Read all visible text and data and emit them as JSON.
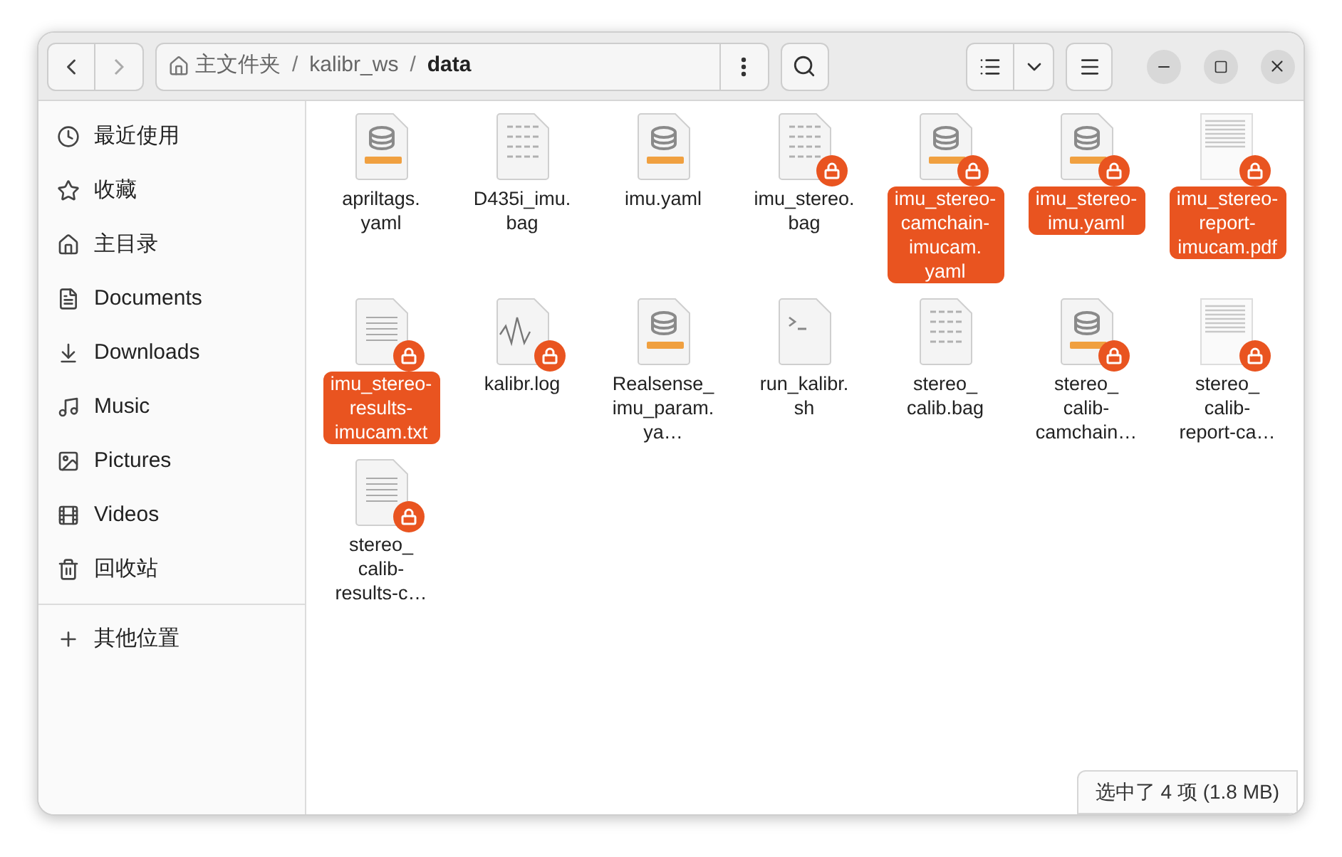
{
  "toolbar": {
    "path": [
      {
        "label": "主文件夹",
        "kind": "home",
        "current": false
      },
      {
        "label": "kalibr_ws",
        "kind": "folder",
        "current": false
      },
      {
        "label": "data",
        "kind": "folder",
        "current": true
      }
    ],
    "separator": "/"
  },
  "sidebar": {
    "items": [
      {
        "label": "最近使用",
        "kind": "recent"
      },
      {
        "label": "收藏",
        "kind": "starred"
      },
      {
        "label": "主目录",
        "kind": "home"
      },
      {
        "label": "Documents",
        "kind": "documents"
      },
      {
        "label": "Downloads",
        "kind": "downloads"
      },
      {
        "label": "Music",
        "kind": "music"
      },
      {
        "label": "Pictures",
        "kind": "pictures"
      },
      {
        "label": "Videos",
        "kind": "videos"
      },
      {
        "label": "回收站",
        "kind": "trash"
      }
    ],
    "other": {
      "label": "其他位置",
      "kind": "plus"
    }
  },
  "files": [
    {
      "name": "apriltags.yaml",
      "kind": "yaml",
      "locked": false,
      "selected": false
    },
    {
      "name": "D435i_imu.bag",
      "kind": "binary",
      "locked": false,
      "selected": false
    },
    {
      "name": "imu.yaml",
      "kind": "yaml",
      "locked": false,
      "selected": false
    },
    {
      "name": "imu_stereo.bag",
      "kind": "binary",
      "locked": true,
      "selected": false
    },
    {
      "name": "imu_stereo-camchain-imucam.yaml",
      "kind": "yaml",
      "locked": true,
      "selected": true
    },
    {
      "name": "imu_stereo-imu.yaml",
      "kind": "yaml",
      "locked": true,
      "selected": true
    },
    {
      "name": "imu_stereo-report-imucam.pdf",
      "kind": "pdf",
      "locked": true,
      "selected": true
    },
    {
      "name": "imu_stereo-results-imucam.txt",
      "kind": "text",
      "locked": true,
      "selected": true
    },
    {
      "name": "kalibr.log",
      "kind": "log",
      "locked": true,
      "selected": false
    },
    {
      "name": "Realsense_imu_param.ya…",
      "kind": "yaml",
      "locked": false,
      "selected": false
    },
    {
      "name": "run_kalibr.sh",
      "kind": "script",
      "locked": false,
      "selected": false
    },
    {
      "name": "stereo_calib.bag",
      "kind": "binary",
      "locked": false,
      "selected": false
    },
    {
      "name": "stereo_calib-camchain…",
      "kind": "yaml",
      "locked": true,
      "selected": false
    },
    {
      "name": "stereo_calib-report-ca…",
      "kind": "pdf",
      "locked": true,
      "selected": false
    },
    {
      "name": "stereo_calib-results-c…",
      "kind": "text",
      "locked": true,
      "selected": false
    }
  ],
  "status_bar": "选中了 4 项 (1.8 MB)"
}
